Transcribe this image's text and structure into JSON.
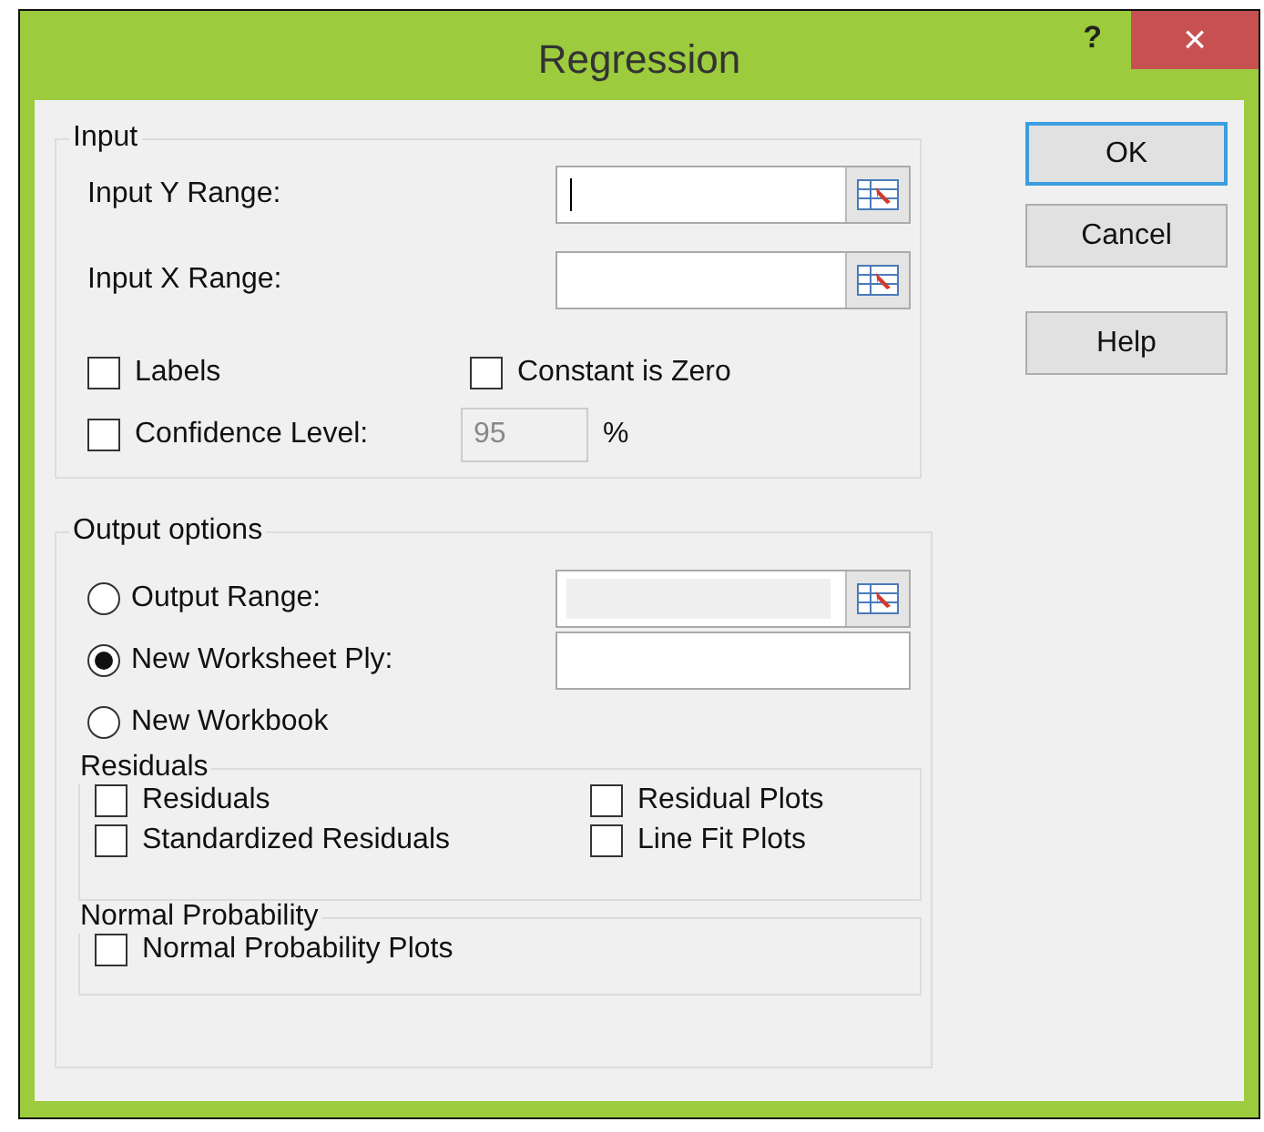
{
  "window": {
    "title": "Regression",
    "help_glyph": "?",
    "close_glyph": "×"
  },
  "input": {
    "title": "Input",
    "ranges": [
      {
        "label": "Input Y Range:",
        "focused": true
      },
      {
        "label": "Input X Range:"
      }
    ],
    "options": [
      {
        "label": "Labels",
        "checked": false
      },
      {
        "label": "Constant is Zero",
        "checked": false
      },
      {
        "label": "Confidence Level:",
        "checked": false
      }
    ],
    "confidence": {
      "value": "95",
      "disabled": true,
      "unit": "%"
    }
  },
  "output": {
    "title": "Output options",
    "choices": [
      {
        "label": "Output Range:",
        "selected": false,
        "field": {
          "disabled": true,
          "ref_button": true
        }
      },
      {
        "label": "New Worksheet Ply:",
        "selected": true,
        "field": {
          "disabled": false,
          "ref_button": false
        }
      },
      {
        "label": "New Workbook",
        "selected": false
      }
    ],
    "residuals": {
      "title": "Residuals",
      "options": [
        {
          "label": "Residuals",
          "checked": false
        },
        {
          "label": "Residual Plots",
          "checked": false
        },
        {
          "label": "Standardized Residuals",
          "checked": false
        },
        {
          "label": "Line Fit Plots",
          "checked": false
        }
      ]
    },
    "normal_probability": {
      "title": "Normal Probability",
      "options": [
        {
          "label": "Normal Probability Plots",
          "checked": false
        }
      ]
    }
  },
  "buttons": [
    {
      "label": "OK",
      "default": true
    },
    {
      "label": "Cancel",
      "default": false
    },
    {
      "label": "Help",
      "default": false
    }
  ]
}
